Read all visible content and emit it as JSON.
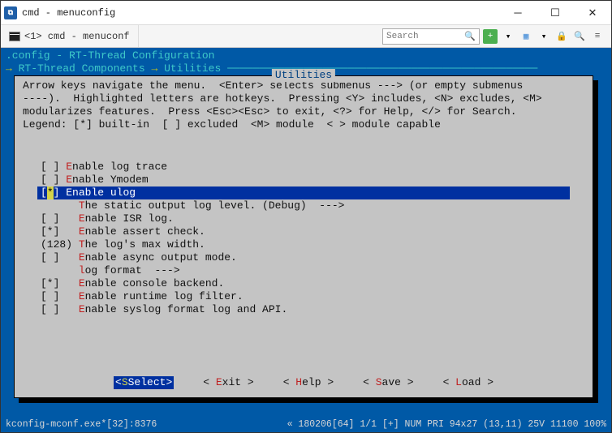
{
  "window": {
    "title": "cmd - menuconfig"
  },
  "tab": {
    "label": "<1> cmd - menuconf"
  },
  "search": {
    "placeholder": "Search"
  },
  "config": {
    "line1": ".config - RT-Thread Configuration",
    "path1": "RT-Thread Components",
    "path2": "Utilities"
  },
  "box": {
    "title": "Utilities",
    "help": "Arrow keys navigate the menu.  <Enter> selects submenus ---> (or empty submenus\n----).  Highlighted letters are hotkeys.  Pressing <Y> includes, <N> excludes, <M>\nmodularizes features.  Press <Esc><Esc> to exit, <?> for Help, </> for Search.\nLegend: [*] built-in  [ ] excluded  <M> module  < > module capable"
  },
  "menu": [
    {
      "prefix": "[ ] ",
      "hk": "E",
      "rest": "nable log trace",
      "sel": false
    },
    {
      "prefix": "[ ] ",
      "hk": "E",
      "rest": "nable Ymodem",
      "sel": false
    },
    {
      "prefix": "[*] ",
      "hk": "E",
      "rest": "nable ulog",
      "sel": true
    },
    {
      "prefix": "      ",
      "hk": "T",
      "rest": "he static output log level. (Debug)  --->",
      "sel": false
    },
    {
      "prefix": "[ ]   ",
      "hk": "E",
      "rest": "nable ISR log.",
      "sel": false
    },
    {
      "prefix": "[*]   ",
      "hk": "E",
      "rest": "nable assert check.",
      "sel": false
    },
    {
      "prefix": "(128) ",
      "hk": "T",
      "rest": "he log's max width.",
      "sel": false
    },
    {
      "prefix": "[ ]   ",
      "hk": "E",
      "rest": "nable async output mode.",
      "sel": false
    },
    {
      "prefix": "      ",
      "hk": "l",
      "rest": "og format  --->",
      "sel": false
    },
    {
      "prefix": "[*]   ",
      "hk": "E",
      "rest": "nable console backend.",
      "sel": false
    },
    {
      "prefix": "[ ]   ",
      "hk": "E",
      "rest": "nable runtime log filter.",
      "sel": false
    },
    {
      "prefix": "[ ]   ",
      "hk": "E",
      "rest": "nable syslog format log and API.",
      "sel": false
    }
  ],
  "buttons": {
    "select": "Select",
    "exit": "xit",
    "help": "elp",
    "save": "ave",
    "load": "oad"
  },
  "status": {
    "left": "kconfig-mconf.exe*[32]:8376",
    "right": "« 180206[64]  1/1  [+] NUM  PRI   94x27  (13,11) 25V  11100  100%"
  }
}
